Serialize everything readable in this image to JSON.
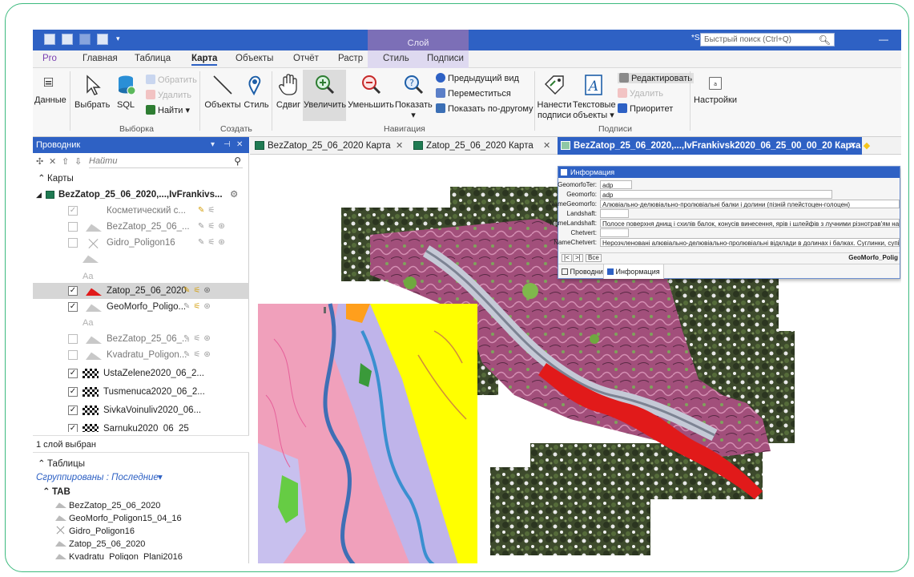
{
  "colors": {
    "accent": "#2e61c4",
    "context_tab": "#7c6fb7",
    "frame_border": "#3dba7e",
    "selected_layer": "#e11a1a"
  },
  "titlebar": {
    "context_group": "Слой",
    "search_placeholder": "Быстрый поиск (Ctrl+Q)"
  },
  "tabs": [
    "Pro",
    "Главная",
    "Таблица",
    "Карта",
    "Объекты",
    "Отчёт",
    "Растр",
    "Стиль",
    "Подписи"
  ],
  "active_tab": "Карта",
  "ribbon": {
    "data": "Данные",
    "select": "Выбрать",
    "sql": "SQL",
    "invert": "Обратить",
    "delete": "Удалить",
    "find": "Найти",
    "objects": "Объекты",
    "style": "Стиль",
    "pan": "Сдвиг",
    "zoom_in": "Увеличить",
    "zoom_out": "Уменьшить",
    "show": "Показать",
    "prev_view": "Предыдущий вид",
    "move": "Переместиться",
    "show_other": "Показать по-другому",
    "label_line1": "Нанести",
    "label_line2": "подписи",
    "text_line1": "Текстовые",
    "text_line2": "объекты",
    "edit": "Редактировать",
    "delete2": "Удалить",
    "priority": "Приоритет",
    "settings": "Настройки",
    "groups": {
      "selection": "Выборка",
      "create": "Создать",
      "navigation": "Навигация",
      "labels": "Подписи"
    }
  },
  "explorer": {
    "title": "Проводник",
    "find_placeholder": "Найти",
    "maps_header": "Карты",
    "map_name": "BezZatop_25_06_2020,...,IvFrankivs...",
    "layers": [
      {
        "name": "Косметический с...",
        "checked": "✓",
        "dim": true
      },
      {
        "name": "BezZatop_25_06_...",
        "checked": "",
        "dim": true
      },
      {
        "name": "Gidro_Poligon16",
        "checked": "",
        "dim": true
      },
      {
        "name": "Zatop_25_06_2020",
        "checked": "✓",
        "dim": false
      },
      {
        "name": "GeoMorfo_Poligo...",
        "checked": "✓",
        "dim": false
      },
      {
        "name": "BezZatop_25_06_...",
        "checked": "",
        "dim": true
      },
      {
        "name": "Kvadratu_Poligon...",
        "checked": "",
        "dim": true
      },
      {
        "name": "UstaZelene2020_06_2...",
        "checked": "✓",
        "dim": false
      },
      {
        "name": "Tusmenuca2020_06_2...",
        "checked": "✓",
        "dim": false
      },
      {
        "name": "SivkaVoinuliv2020_06...",
        "checked": "✓",
        "dim": false
      },
      {
        "name": "Sarnuku2020_06_25",
        "checked": "✓",
        "dim": false
      }
    ],
    "aa_label": "Aa",
    "status": "1 слой выбран",
    "tables_header": "Таблицы",
    "grouped_by": "Сгруппированы : Последние",
    "tab_group": "TAB",
    "tables": [
      "BezZatop_25_06_2020",
      "GeoMorfo_Poligon15_04_16",
      "Gidro_Poligon16",
      "Zatop_25_06_2020",
      "Kvadratu_Poligon_Plani2016"
    ]
  },
  "doc_tabs": [
    "BezZatop_25_06_2020 Карта",
    "Zatop_25_06_2020 Карта",
    "BezZatop_25_06_2020,...,IvFrankivsk2020_06_25_00_00_20 Карта"
  ],
  "info_window": {
    "title": "Информация",
    "fields": [
      {
        "key": "GeomorfoTer:",
        "value": "adp"
      },
      {
        "key": "Geomorfo:",
        "value": "adp"
      },
      {
        "key": "NameGeomorfo:",
        "value": "Алювіально-делювіально-пролювіальні балки і долини (пізній плейстоцен-голоцен)"
      },
      {
        "key": "Landshaft:",
        "value": ""
      },
      {
        "key": "NameLandshaft:",
        "value": "Полосе поверхня днищ і схилів балок, конусів винесення, ярів і шлейфів з лучними різнотрав'ям на дерново - підзолистих ґрунтах"
      },
      {
        "key": "Chetvert:",
        "value": ""
      },
      {
        "key": "NameChetvert:",
        "value": "Нерозчленовані алювіально-делювіально-пролювіальні відклади в долинах і балках. Суглинки, супіски, піски, щебінь"
      }
    ],
    "nav_all": "Все",
    "record_table": "GeoMorfo_Polig",
    "tab_explorer": "Проводник",
    "tab_info": "Информация"
  }
}
